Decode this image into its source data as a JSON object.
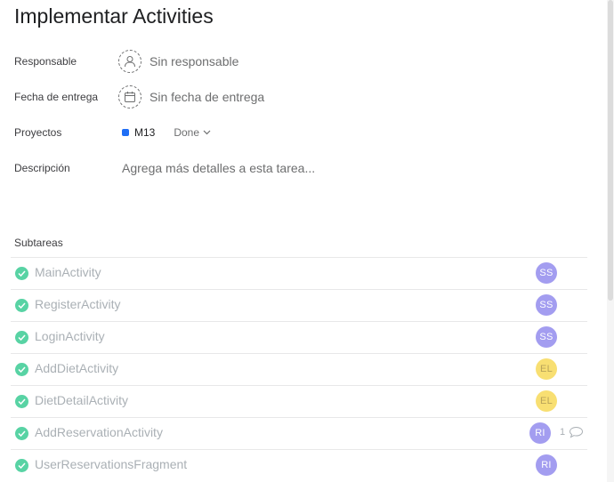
{
  "task": {
    "title": "Implementar Activities"
  },
  "fields": {
    "assignee": {
      "label": "Responsable",
      "value": "Sin responsable",
      "icon": "person-icon"
    },
    "due_date": {
      "label": "Fecha de entrega",
      "value": "Sin fecha de entrega",
      "icon": "calendar-icon"
    },
    "projects": {
      "label": "Proyectos",
      "project_name": "M13",
      "project_color": "#1f6ef5",
      "status": "Done",
      "icon": "chevron-down-icon"
    },
    "description": {
      "label": "Descripción",
      "placeholder": "Agrega más detalles a esta tarea..."
    }
  },
  "subtasks": {
    "label": "Subtareas",
    "items": [
      {
        "name": "MainActivity",
        "completed": true,
        "assignee_initials": "SS",
        "assignee_color": "#a39df0"
      },
      {
        "name": "RegisterActivity",
        "completed": true,
        "assignee_initials": "SS",
        "assignee_color": "#a39df0"
      },
      {
        "name": "LoginActivity",
        "completed": true,
        "assignee_initials": "SS",
        "assignee_color": "#a39df0"
      },
      {
        "name": "AddDietActivity",
        "completed": true,
        "assignee_initials": "EL",
        "assignee_color": "#f8df72"
      },
      {
        "name": "DietDetailActivity",
        "completed": true,
        "assignee_initials": "EL",
        "assignee_color": "#f8df72"
      },
      {
        "name": "AddReservationActivity",
        "completed": true,
        "assignee_initials": "RI",
        "assignee_color": "#a39df0",
        "comment_count": "1"
      },
      {
        "name": "UserReservationsFragment",
        "completed": true,
        "assignee_initials": "RI",
        "assignee_color": "#a39df0"
      }
    ]
  },
  "colors": {
    "check_green": "#58d3a4",
    "muted_text": "#aab0b5",
    "avatar_text_on_yellow": "#b8a35a"
  }
}
